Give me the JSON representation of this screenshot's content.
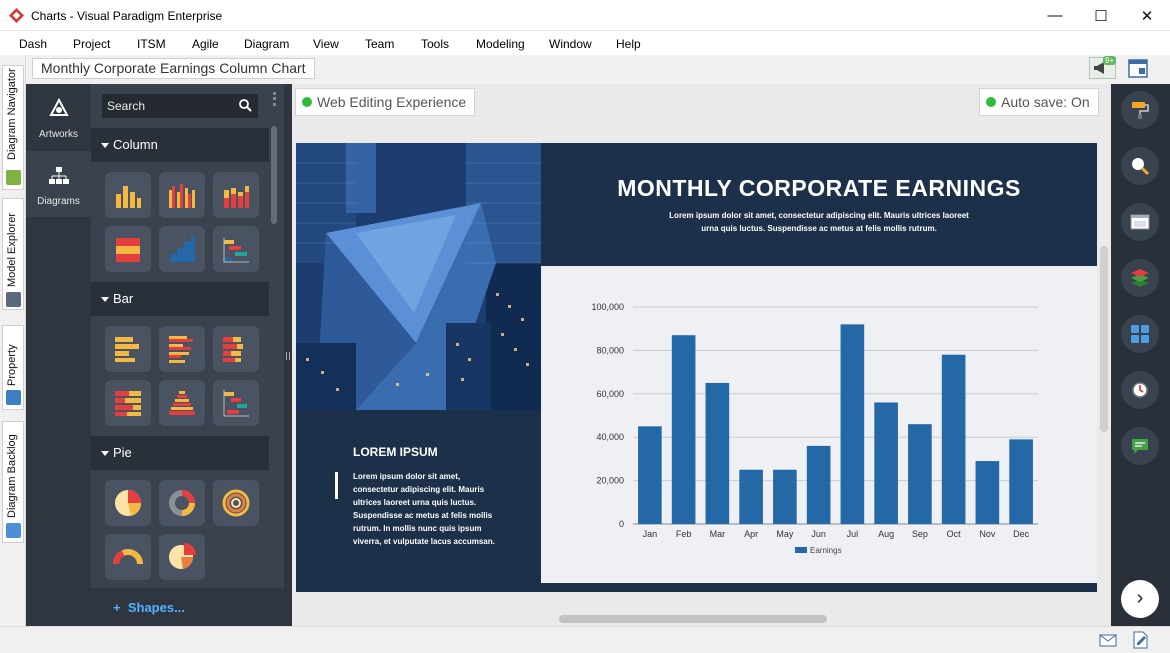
{
  "window": {
    "title": "Charts - Visual Paradigm Enterprise",
    "minimize": "—",
    "maximize": "☐",
    "close": "✕"
  },
  "menu": [
    "Dash",
    "Project",
    "ITSM",
    "Agile",
    "Diagram",
    "View",
    "Team",
    "Tools",
    "Modeling",
    "Window",
    "Help"
  ],
  "breadcrumb": "Monthly Corporate Earnings Column Chart",
  "notification_badge": "9+",
  "left_tabs": [
    "Diagram Navigator",
    "Model Explorer",
    "Property",
    "Diagram Backlog"
  ],
  "palette_nav": {
    "artworks": "Artworks",
    "diagrams": "Diagrams"
  },
  "palette": {
    "search_placeholder": "Search",
    "sections": [
      "Column",
      "Bar",
      "Pie"
    ],
    "shapes_link": "Shapes..."
  },
  "canvas": {
    "web_editing": "Web Editing Experience",
    "auto_save": "Auto save: On"
  },
  "poster": {
    "title": "MONTHLY CORPORATE EARNINGS",
    "subtitle": "Lorem ipsum dolor sit amet, consectetur adipiscing elit. Mauris ultrices laoreet urna quis luctus. Suspendisse ac metus at felis mollis rutrum.",
    "side_title": "LOREM IPSUM",
    "side_body": "Lorem ipsum dolor sit amet, consectetur adipiscing elit. Mauris ultrices laoreet urna quis luctus. Suspendisse ac metus at felis mollis rutrum. In mollis nunc quis ipsum viverra, et vulputate lacus accumsan."
  },
  "colors": {
    "bar": "#2468a8",
    "poster_bg": "#1c3149",
    "status_green": "#2dbb3c",
    "link_blue": "#4fb3ff"
  },
  "chart_data": {
    "type": "bar",
    "categories": [
      "Jan",
      "Feb",
      "Mar",
      "Apr",
      "May",
      "Jun",
      "Jul",
      "Aug",
      "Sep",
      "Oct",
      "Nov",
      "Dec"
    ],
    "series": [
      {
        "name": "Earnings",
        "values": [
          45000,
          87000,
          65000,
          25000,
          25000,
          36000,
          92000,
          56000,
          46000,
          78000,
          29000,
          39000
        ]
      }
    ],
    "ylim": [
      0,
      100000
    ],
    "yticks": [
      0,
      20000,
      40000,
      60000,
      80000,
      100000
    ],
    "ytick_labels": [
      "0",
      "20,000",
      "40,000",
      "60,000",
      "80,000",
      "100,000"
    ],
    "grid": true,
    "legend": "bottom"
  }
}
